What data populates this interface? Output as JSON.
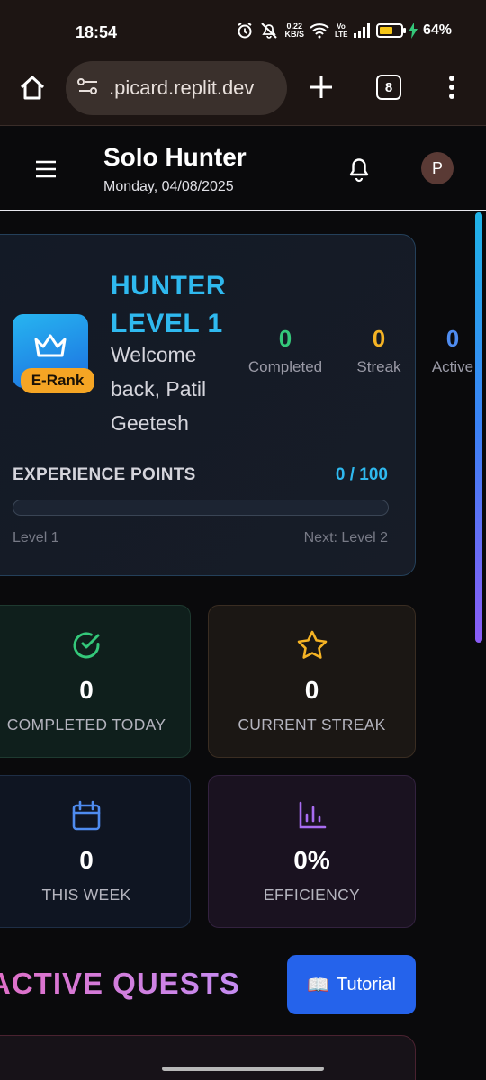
{
  "status_bar": {
    "time": "18:54",
    "net_speed_value": "0.22",
    "net_speed_unit": "KB/S",
    "network_label": "Vo LTE",
    "battery_percent_text": "64%",
    "battery_level": 0.64
  },
  "browser": {
    "url": ".picard.replit.dev",
    "tab_count": "8"
  },
  "header": {
    "title": "Solo Hunter",
    "date": "Monday, 04/08/2025",
    "avatar_initial": "P"
  },
  "hunter": {
    "level_title": "HUNTER LEVEL 1",
    "rank_label": "E-Rank",
    "welcome": "Welcome back, Patil Geetesh",
    "stats": [
      {
        "value": "0",
        "label": "Completed",
        "color": "#34c87a"
      },
      {
        "value": "0",
        "label": "Streak",
        "color": "#f5b324"
      },
      {
        "value": "0",
        "label": "Active",
        "color": "#4f8cf0"
      }
    ],
    "xp_label": "EXPERIENCE POINTS",
    "xp_value": "0 / 100",
    "xp_progress": 0,
    "level_current": "Level 1",
    "level_next": "Next: Level 2"
  },
  "tiles": [
    {
      "icon": "check-circle-icon",
      "value": "0",
      "label": "COMPLETED TODAY",
      "color": "#34c87a"
    },
    {
      "icon": "star-icon",
      "value": "0",
      "label": "CURRENT STREAK",
      "color": "#f5b324"
    },
    {
      "icon": "calendar-icon",
      "value": "0",
      "label": "THIS WEEK",
      "color": "#4f8cf0"
    },
    {
      "icon": "bar-chart-icon",
      "value": "0%",
      "label": "EFFICIENCY",
      "color": "#a86cf0"
    }
  ],
  "quests": {
    "title": "ACTIVE QUESTS",
    "tutorial_label": "Tutorial",
    "tutorial_icon": "📖"
  },
  "colors": {
    "accent_cyan": "#2fb9ef",
    "tutorial_blue": "#2563eb",
    "rank_orange": "#f5a524"
  }
}
